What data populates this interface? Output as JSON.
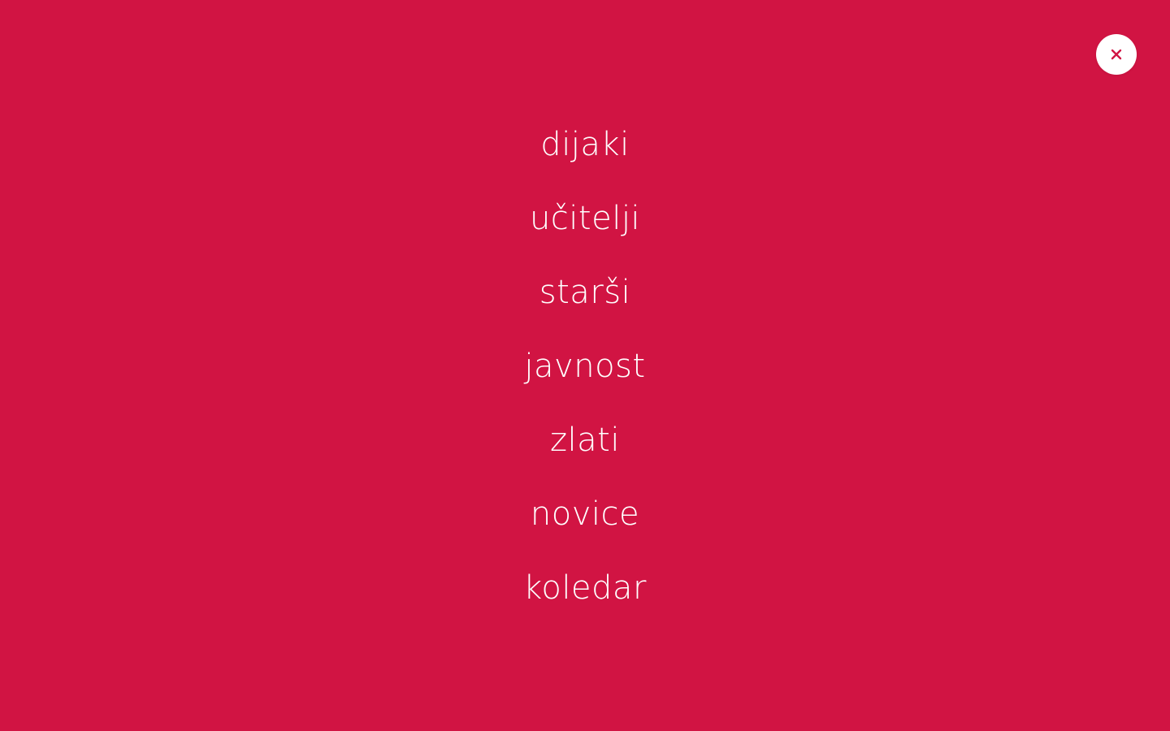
{
  "colors": {
    "background": "#d11443",
    "text": "#ffffff",
    "close_button_bg": "#ffffff",
    "close_icon": "#d11443"
  },
  "close_button": {
    "icon": "close-icon"
  },
  "menu": {
    "items": [
      {
        "label": "dijaki"
      },
      {
        "label": "učitelji"
      },
      {
        "label": "starši"
      },
      {
        "label": "javnost"
      },
      {
        "label": "zlati"
      },
      {
        "label": "novice"
      },
      {
        "label": "koledar"
      }
    ]
  }
}
